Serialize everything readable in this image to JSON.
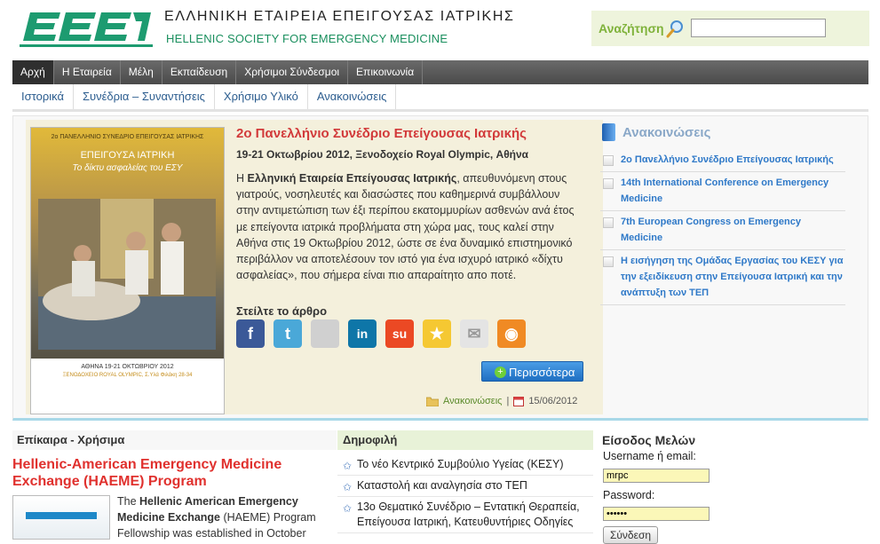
{
  "header": {
    "title_gr": "ΕΛΛΗΝΙΚΗ ΕΤΑΙΡΕΙΑ ΕΠΕΙΓΟΥΣΑΣ ΙΑΤΡΙΚΗΣ",
    "title_en": "HELLENIC SOCIETY FOR EMERGENCY MEDICINE",
    "logo_icon": "eeei-logo",
    "search": {
      "label": "Αναζήτηση",
      "value": "",
      "icon": "magnifier-icon"
    }
  },
  "nav": {
    "items": [
      "Αρχή",
      "Η Εταιρεία",
      "Μέλη",
      "Εκπαίδευση",
      "Χρήσιμοι Σύνδεσμοι",
      "Επικοινωνία"
    ],
    "active": "Αρχή"
  },
  "subnav": {
    "items": [
      "Ιστορικά",
      "Συνέδρια – Συναντήσεις",
      "Χρήσιμο Υλικό",
      "Ανακοινώσεις"
    ]
  },
  "featured": {
    "poster": {
      "top": "2ο ΠΑΝΕΛΛΗΝΙΟ ΣΥΝΕΔΡΙΟ ΕΠΕΙΓΟΥΣΑΣ ΙΑΤΡΙΚΗΣ",
      "title": "ΕΠΕΙΓΟΥΣΑ ΙΑΤΡΙΚΗ",
      "subtitle": "Το δίκτυ ασφαλείας του ΕΣΥ",
      "date": "ΑΘΗΝΑ 19-21 ΟΚΤΩΒΡΙΟΥ 2012",
      "venue": "ΞΕΝΟΔΟΧΕΙΟ ROYAL OLYMPIC, Σ.Υλά Φιλάκη 28-34"
    },
    "title": "2ο Πανελλήνιο Συνέδριο Επείγουσας Ιατρικής",
    "date_line": "19-21 Οκτωβρίου 2012, Ξενοδοχείο Royal Olympic, Αθήνα",
    "body_pre": "Η ",
    "body_bold": "Ελληνική Εταιρεία Επείγουσας Ιατρικής",
    "body_post": ", απευθυνόμενη στους γιατρούς, νοσηλευτές και διασώστες που καθημερινά συμβάλλουν στην αντιμετώπιση των έξι περίπου εκατομμυρίων ασθενών ανά έτος με επείγοντα ιατρικά προβλήματα στη χώρα μας, τους καλεί στην Αθήνα στις 19 Οκτωβρίου 2012, ώστε σε ένα δυναμικό επιστημονικό περιβάλλον να αποτελέσουν τον ιστό για ένα ισχυρό ιατρικό «δίχτυ ασφαλείας», που σήμερα είναι πιο απαραίτητο απο ποτέ.",
    "share_title": "Στείλτε το άρθρο",
    "share": [
      {
        "icon": "facebook-icon",
        "glyph": "f",
        "color": "#3b5998"
      },
      {
        "icon": "twitter-icon",
        "glyph": "t",
        "color": "#4aa8d8"
      },
      {
        "icon": "delicious-icon",
        "glyph": "",
        "color": "#d0d0d0"
      },
      {
        "icon": "linkedin-icon",
        "glyph": "in",
        "color": "#0e76a8"
      },
      {
        "icon": "stumbleupon-icon",
        "glyph": "su",
        "color": "#eb4924"
      },
      {
        "icon": "favorite-icon",
        "glyph": "★",
        "color": "#f5c832"
      },
      {
        "icon": "email-icon",
        "glyph": "✉",
        "color": "#e4e4e4"
      },
      {
        "icon": "rss-icon",
        "glyph": "◉",
        "color": "#f08a24"
      }
    ],
    "more_label": "Περισσότερα",
    "category": "Ανακοινώσεις",
    "separator": "|",
    "date": "15/06/2012"
  },
  "announcements": {
    "title": "Ανακοινώσεις",
    "items": [
      "2ο Πανελλήνιο Συνέδριο Επείγουσας Ιατρικής",
      "14th International Conference on Emergency Medicine",
      "7th European Congress on Emergency Medicine",
      "Η εισήγηση της Ομάδας Εργασίας του ΚΕΣΥ για την εξειδίκευση στην Επείγουσα Ιατρική και την ανάπτυξη των ΤΕΠ"
    ]
  },
  "news": {
    "header": "Επίκαιρα - Χρήσιμα",
    "title": "Hellenic-American Emergency Medicine Exchange (HAEME) Program",
    "text_pre": "The ",
    "text_bold": "Hellenic American Emergency Medicine Exchange",
    "text_post": " (HAEME) Program Fellowship was established in October"
  },
  "popular": {
    "header": "Δημοφιλή",
    "items": [
      "Το νέο Κεντρικό Συμβούλιο Υγείας (ΚΕΣΥ)",
      "Καταστολή και αναλγησία στο ΤΕΠ",
      "13ο Θεματικό Συνέδριο – Εντατική Θεραπεία, Επείγουσα Ιατρική, Κατευθυντήριες Οδηγίες"
    ]
  },
  "login": {
    "header": "Είσοδος Μελών",
    "username_label": "Username ή email:",
    "username_value": "mrpc",
    "password_label": "Password:",
    "password_value": "••••••",
    "submit": "Σύνδεση"
  }
}
